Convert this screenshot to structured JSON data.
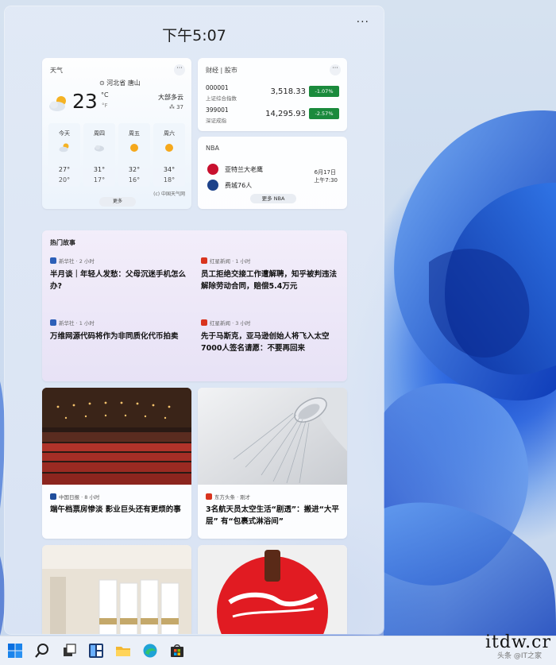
{
  "panel": {
    "time": "下午5:07",
    "more_label": "···"
  },
  "weather": {
    "title": "天气",
    "more_label": "···",
    "location": "河北省 唐山",
    "temperature": "23",
    "unit_c": "°C",
    "unit_f": "°F",
    "condition": "大部多云",
    "humidity": "37",
    "forecast": [
      {
        "day": "今天",
        "icon": "partly-cloudy-icon",
        "high": "27°",
        "low": "20°"
      },
      {
        "day": "周四",
        "icon": "cloudy-icon",
        "high": "31°",
        "low": "17°"
      },
      {
        "day": "周五",
        "icon": "sunny-icon",
        "high": "32°",
        "low": "16°"
      },
      {
        "day": "周六",
        "icon": "sunny-icon",
        "high": "34°",
        "low": "18°"
      }
    ],
    "source": "(c) 中国天气网",
    "more_button": "更多"
  },
  "stocks": {
    "title": "财经 | 股市",
    "more_label": "···",
    "rows": [
      {
        "code": "000001",
        "name": "上证综合指数",
        "value": "3,518.33",
        "change": "-1.07%"
      },
      {
        "code": "399001",
        "name": "深证成指",
        "value": "14,295.93",
        "change": "-2.57%"
      }
    ],
    "change_color": "#1a8a3c"
  },
  "nba": {
    "title": "NBA",
    "teams": [
      {
        "name": "亚特兰大老鹰",
        "color": "#c8102e"
      },
      {
        "name": "费城76人",
        "color": "#1d428a"
      }
    ],
    "date": "6月17日",
    "time": "上午7:30",
    "more_button": "更多 NBA"
  },
  "top_stories": {
    "title": "热门故事",
    "items": [
      {
        "source": "新华社 · 2 小时",
        "source_color": "#2c5fb8",
        "headline": "半月谈｜年轻人发愁：父母沉迷手机怎么办?"
      },
      {
        "source": "红星新闻 · 1 小时",
        "source_color": "#d9341e",
        "headline": "员工拒绝交接工作遭解聘，知乎被判违法解除劳动合同，赔偿5.4万元"
      },
      {
        "source": "新华社 · 1 小时",
        "source_color": "#2c5fb8",
        "headline": "万维网源代码将作为非同质化代币拍卖"
      },
      {
        "source": "红星新闻 · 3 小时",
        "source_color": "#d9341e",
        "headline": "先于马斯克，亚马逊创始人将飞入太空 7000人签名请愿：不要再回来"
      }
    ]
  },
  "image_cards": [
    {
      "source": "中国日报 · 8 小时",
      "source_color": "#1f4e9c",
      "headline": "端午档票房惨淡 影业巨头还有更烦的事"
    },
    {
      "source": "东方头条 · 刚才",
      "source_color": "#d9341e",
      "headline": "3名航天员太空生活“剧透”：搬进“大平层” 有“包裹式淋浴间”"
    }
  ],
  "taskbar": {
    "icons": [
      "windows-start-icon",
      "search-icon",
      "task-view-icon",
      "widgets-icon",
      "file-explorer-icon",
      "edge-browser-icon",
      "store-icon"
    ]
  },
  "watermark": {
    "text": "itdw.cr",
    "sub": "头条 @IT之家"
  }
}
